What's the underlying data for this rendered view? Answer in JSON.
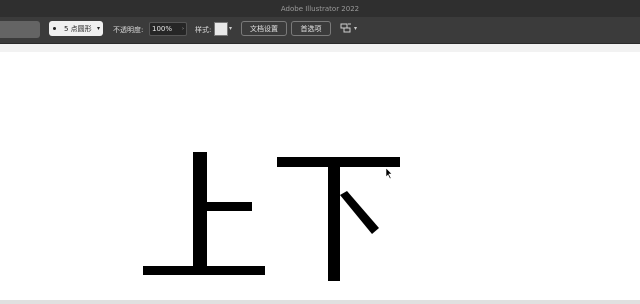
{
  "window": {
    "title": "Adobe Illustrator 2022"
  },
  "control_bar": {
    "brush": {
      "label": "5 点圆形",
      "icon": "round-brush-dot"
    },
    "opacity": {
      "label": "不透明度:",
      "value": "100%"
    },
    "style": {
      "label": "样式:",
      "swatch_color": "#e8e8e8"
    },
    "document_setup_button": "文档设置",
    "preferences_button": "首选项",
    "arrange_icon": "arrange-documents-icon"
  },
  "artwork": {
    "characters": [
      "上",
      "下"
    ],
    "stroke_color": "#000000"
  },
  "colors": {
    "titlebar": "#2f2f2f",
    "toolbar": "#3b3b3b",
    "canvas": "#ffffff"
  }
}
